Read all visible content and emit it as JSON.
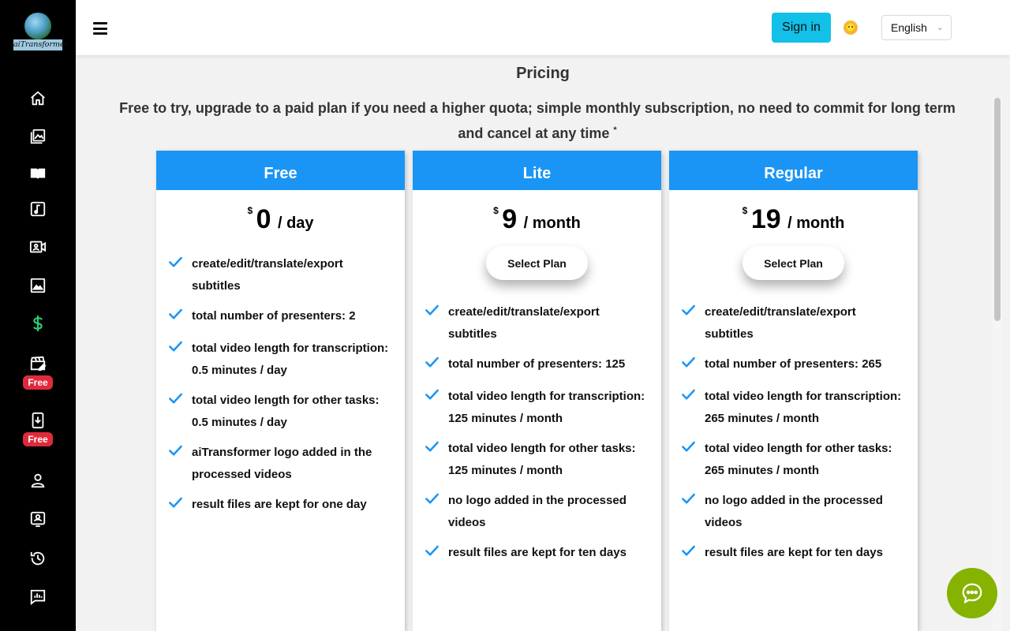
{
  "app": {
    "logo_text": "aiTransformer"
  },
  "sidebar": {
    "items": [
      {
        "icon": "home-icon"
      },
      {
        "icon": "gallery-icon"
      },
      {
        "icon": "book-icon"
      },
      {
        "icon": "music-icon"
      },
      {
        "icon": "video-presenter-icon"
      },
      {
        "icon": "image-icon"
      },
      {
        "icon": "dollar-icon",
        "active_color": "#2ecc71"
      },
      {
        "icon": "clapperboard-edit-icon",
        "badge": "Free"
      },
      {
        "icon": "phone-download-icon",
        "badge": "Free"
      },
      {
        "icon": "user-icon"
      },
      {
        "icon": "contact-card-icon"
      },
      {
        "icon": "history-icon"
      },
      {
        "icon": "feedback-chart-icon"
      }
    ]
  },
  "header": {
    "signin_label": "Sign in",
    "language": "English",
    "emoji": "😶"
  },
  "page": {
    "title": "Pricing",
    "subtitle": "Free to try, upgrade to a paid plan if you need a higher quota; simple monthly subscription, no need to commit for long term and cancel at any time",
    "subtitle_mark": "*"
  },
  "plans": [
    {
      "name": "Free",
      "currency": "$",
      "amount": "0",
      "period": "/ day",
      "select_label": null,
      "features": [
        "create/edit/translate/export subtitles",
        "total number of presenters: 2",
        "total video length for transcription: 0.5 minutes / day",
        "total video length for other tasks: 0.5 minutes / day",
        "aiTransformer logo added in the processed videos",
        "result files are kept for one day"
      ]
    },
    {
      "name": "Lite",
      "currency": "$",
      "amount": "9",
      "period": "/ month",
      "select_label": "Select Plan",
      "features": [
        "create/edit/translate/export subtitles",
        "total number of presenters: 125",
        "total video length for transcription: 125 minutes / month",
        "total video length for other tasks: 125 minutes / month",
        "no logo added in the processed videos",
        "result files are kept for ten days"
      ]
    },
    {
      "name": "Regular",
      "currency": "$",
      "amount": "19",
      "period": "/ month",
      "select_label": "Select Plan",
      "features": [
        "create/edit/translate/export subtitles",
        "total number of presenters: 265",
        "total video length for transcription: 265 minutes / month",
        "total video length for other tasks: 265 minutes / month",
        "no logo added in the processed videos",
        "result files are kept for ten days"
      ]
    }
  ],
  "colors": {
    "plan_header": "#1a95f5",
    "signin_button": "#12c0e8",
    "check": "#1a95f5",
    "free_badge": "#e02a3c",
    "chat_button": "#86b300"
  }
}
